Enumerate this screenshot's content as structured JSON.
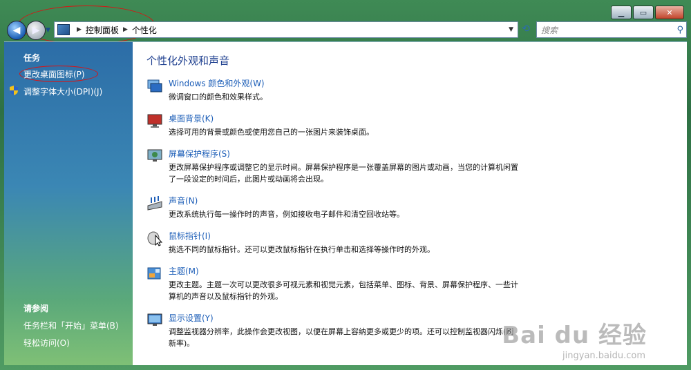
{
  "window": {
    "caption_buttons": {
      "minimize": "▁",
      "maximize": "▭",
      "close": "✕"
    }
  },
  "address_bar": {
    "crumbs": [
      "控制面板",
      "个性化"
    ],
    "search_placeholder": "搜索"
  },
  "sidebar": {
    "tasks_heading": "任务",
    "tasks": [
      "更改桌面图标(P)",
      "调整字体大小(DPI)(J)"
    ],
    "see_also_heading": "请参阅",
    "see_also": [
      "任务栏和「开始」菜单(B)",
      "轻松访问(O)"
    ]
  },
  "main": {
    "title": "个性化外观和声音",
    "items": [
      {
        "icon": "window-color-icon",
        "link": "Windows 颜色和外观(W)",
        "desc": "微调窗口的颜色和效果样式。"
      },
      {
        "icon": "desktop-background-icon",
        "link": "桌面背景(K)",
        "desc": "选择可用的背景或颜色或使用您自己的一张图片来装饰桌面。"
      },
      {
        "icon": "screensaver-icon",
        "link": "屏幕保护程序(S)",
        "desc": "更改屏幕保护程序或调整它的显示时间。屏幕保护程序是一张覆盖屏幕的图片或动画，当您的计算机闲置了一段设定的时间后，此图片或动画将会出现。"
      },
      {
        "icon": "sound-icon",
        "link": "声音(N)",
        "desc": "更改系统执行每一操作时的声音，例如接收电子邮件和清空回收站等。"
      },
      {
        "icon": "mouse-pointer-icon",
        "link": "鼠标指针(I)",
        "desc": "挑选不同的鼠标指针。还可以更改鼠标指针在执行单击和选择等操作时的外观。"
      },
      {
        "icon": "theme-icon",
        "link": "主题(M)",
        "desc": "更改主题。主题一次可以更改很多可视元素和视觉元素，包括菜单、图标、背景、屏幕保护程序、一些计算机的声音以及鼠标指针的外观。"
      },
      {
        "icon": "display-settings-icon",
        "link": "显示设置(Y)",
        "desc": "调整监视器分辨率，此操作会更改视图，以便在屏幕上容纳更多或更少的项。还可以控制监视器闪烁(刷新率)。"
      }
    ]
  },
  "watermark": {
    "brand": "Bai du 经验",
    "url": "jingyan.baidu.com"
  }
}
